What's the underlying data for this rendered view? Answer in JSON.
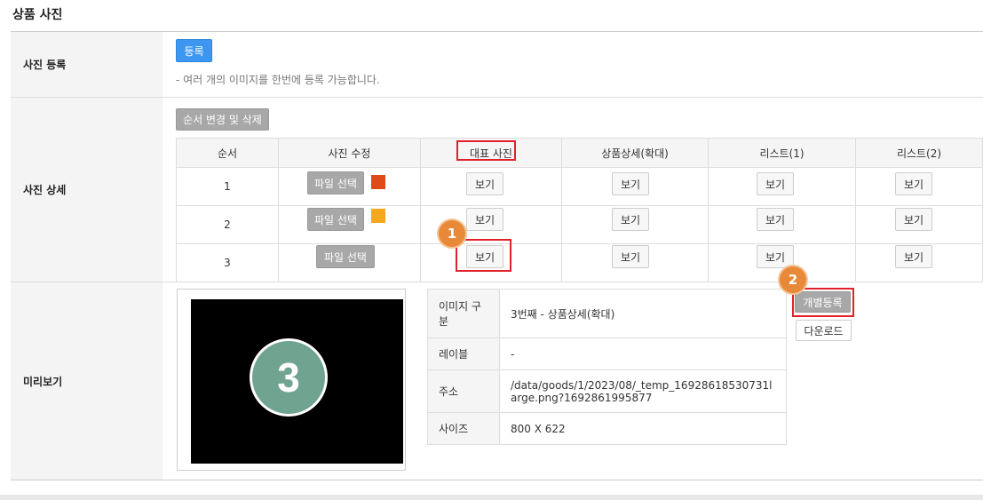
{
  "section_title": "상품 사진",
  "register": {
    "label": "사진 등록",
    "button": "등록",
    "note": "- 여러 개의 이미지를 한번에 등록 가능합니다."
  },
  "detail": {
    "label": "사진 상세",
    "order_button": "순서 변경 및 삭제",
    "headers": [
      "순서",
      "사진 수정",
      "대표 사진",
      "상품상세(확대)",
      "리스트(1)",
      "리스트(2)"
    ],
    "rows": [
      {
        "order": "1",
        "file_button": "파일 선택",
        "swatch": "#e04a18"
      },
      {
        "order": "2",
        "file_button": "파일 선택",
        "swatch": "#f5a81c"
      },
      {
        "order": "3",
        "file_button": "파일 선택",
        "swatch": ""
      }
    ],
    "view_label": "보기"
  },
  "preview": {
    "label": "미리보기",
    "image_number": "3",
    "info": [
      {
        "key": "이미지 구분",
        "value": "3번째 - 상품상세(확대)"
      },
      {
        "key": "레이블",
        "value": "-"
      },
      {
        "key": "주소",
        "value": "/data/goods/1/2023/08/_temp_16928618530731large.png?1692861995877"
      },
      {
        "key": "사이즈",
        "value": "800 X 622"
      }
    ],
    "individual_register": "개별등록",
    "download": "다운로드"
  },
  "annotations": {
    "badge1": "1",
    "badge2": "2"
  },
  "colors": {
    "accent_blue": "#3d97f0",
    "highlight_red": "#e0202a",
    "badge_orange": "#e8893a"
  }
}
